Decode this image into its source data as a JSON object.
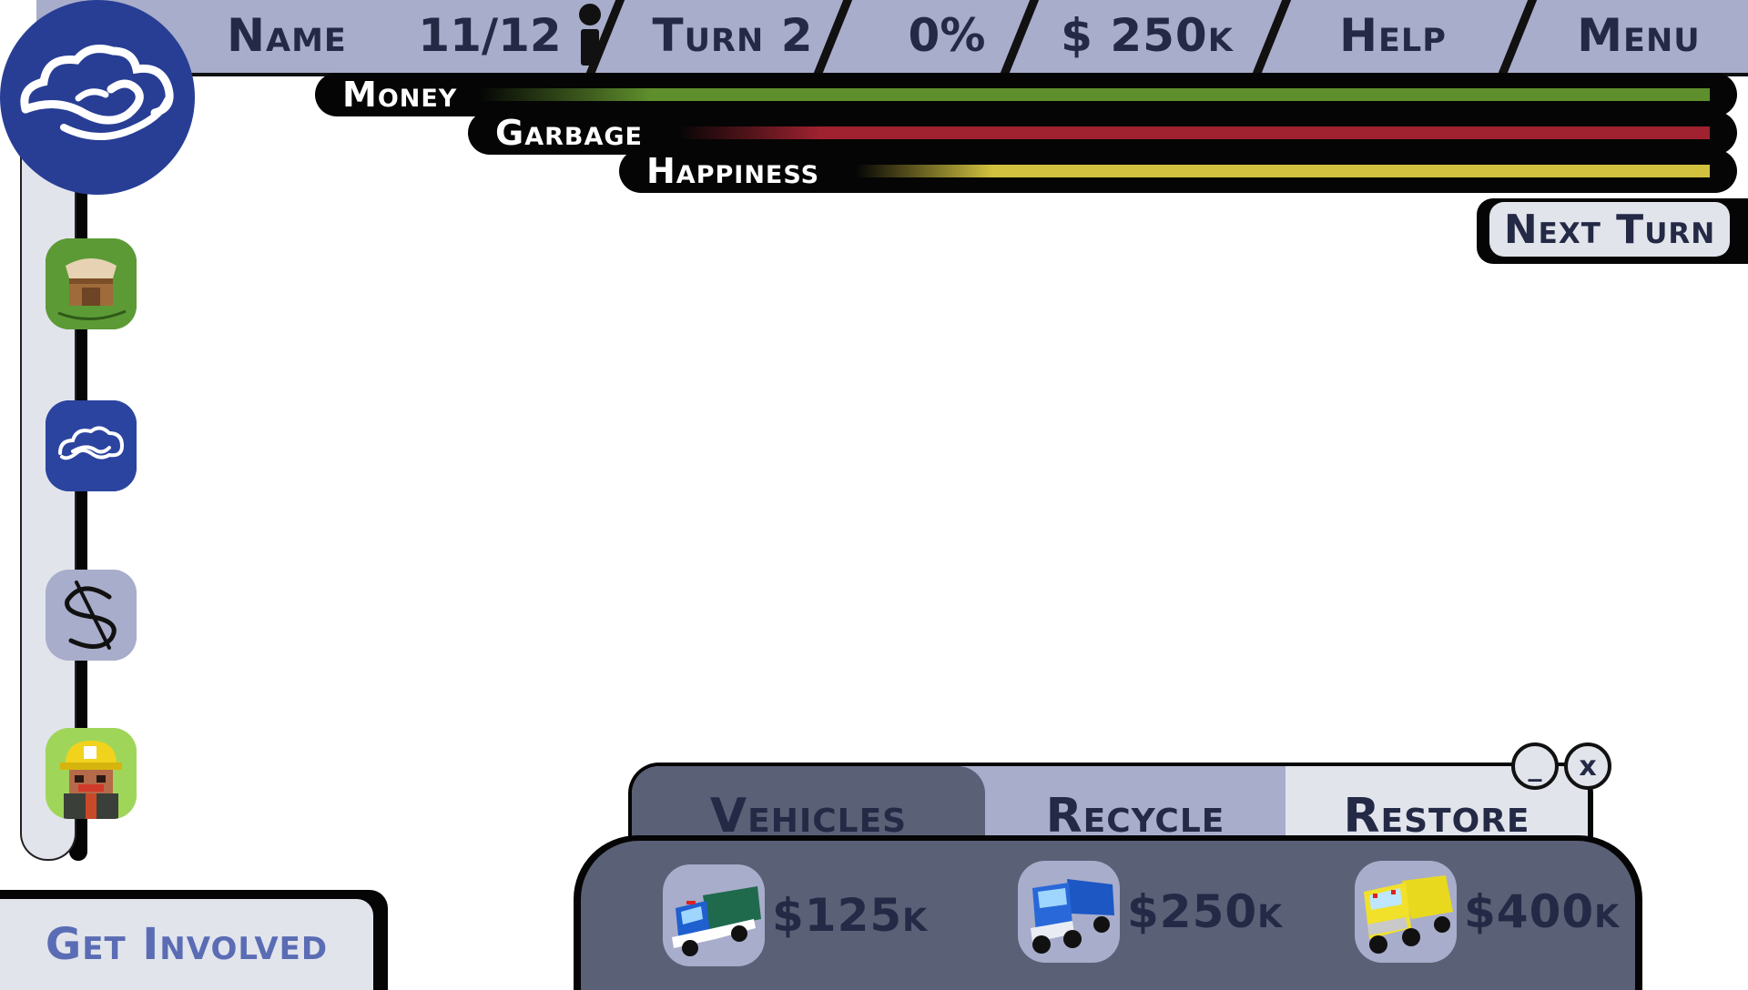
{
  "topbar": {
    "name": "Name",
    "population": "11/12",
    "turn": "Turn 2",
    "percent": "0%",
    "money": "$ 250k",
    "help": "Help",
    "menu": "Menu"
  },
  "meters": [
    {
      "label": "Money",
      "color": "#5f8f2c",
      "fill": 1.0
    },
    {
      "label": "Garbage",
      "color": "#a02230",
      "fill": 1.0
    },
    {
      "label": "Happiness",
      "color": "#d1c13f",
      "fill": 1.0
    }
  ],
  "sidebar": {
    "items": [
      {
        "icon": "market-stall-icon"
      },
      {
        "icon": "cloud-wave-icon"
      },
      {
        "icon": "dollar-icon"
      },
      {
        "icon": "worker-icon"
      }
    ]
  },
  "next_turn_label": "Next Turn",
  "get_involved_label": "Get Involved",
  "panel": {
    "tabs": [
      {
        "label": "Vehicles",
        "active": true
      },
      {
        "label": "Recycle",
        "active": false
      },
      {
        "label": "Restore",
        "active": false
      }
    ],
    "minimize_label": "_",
    "close_label": "x",
    "vehicles": [
      {
        "price": "$125k",
        "icon": "garbage-truck-icon",
        "color": "#1f5fcf"
      },
      {
        "price": "$250k",
        "icon": "dump-truck-icon",
        "color": "#2868d8"
      },
      {
        "price": "$400k",
        "icon": "yellow-truck-icon",
        "color": "#f1e12a"
      }
    ]
  },
  "colors": {
    "accent_blue": "#283e95",
    "bar_grey": "#a8adcb",
    "panel_dark": "#5a6076"
  }
}
